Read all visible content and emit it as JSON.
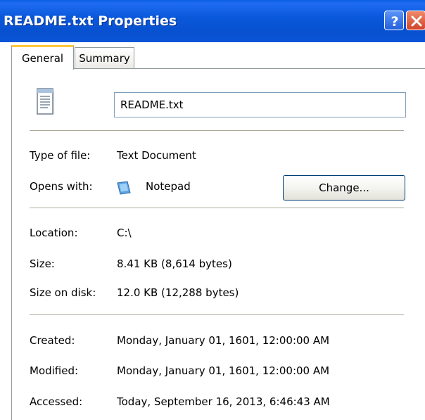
{
  "window": {
    "title": "README.txt Properties",
    "help_icon": "help-icon",
    "close_icon": "close-icon",
    "titlebar_color": "#0a58db"
  },
  "tabs": [
    {
      "label": "General",
      "active": true
    },
    {
      "label": "Summary",
      "active": false
    }
  ],
  "general": {
    "file_icon": "text-document-icon",
    "file_name": "README.txt",
    "type_label": "Type of file:",
    "type_value": "Text Document",
    "opens_label": "Opens with:",
    "opens_icon": "notepad-icon",
    "opens_value": "Notepad",
    "change_button": "Change...",
    "location_label": "Location:",
    "location_value": "C:\\",
    "size_label": "Size:",
    "size_value": "8.41 KB (8,614 bytes)",
    "size_on_disk_label": "Size on disk:",
    "size_on_disk_value": "12.0 KB (12,288 bytes)",
    "created_label": "Created:",
    "created_value": "Monday, January 01, 1601, 12:00:00 AM",
    "modified_label": "Modified:",
    "modified_value": "Monday, January 01, 1601, 12:00:00 AM",
    "accessed_label": "Accessed:",
    "accessed_value": "Today, September 16, 2013, 6:46:43 AM"
  }
}
